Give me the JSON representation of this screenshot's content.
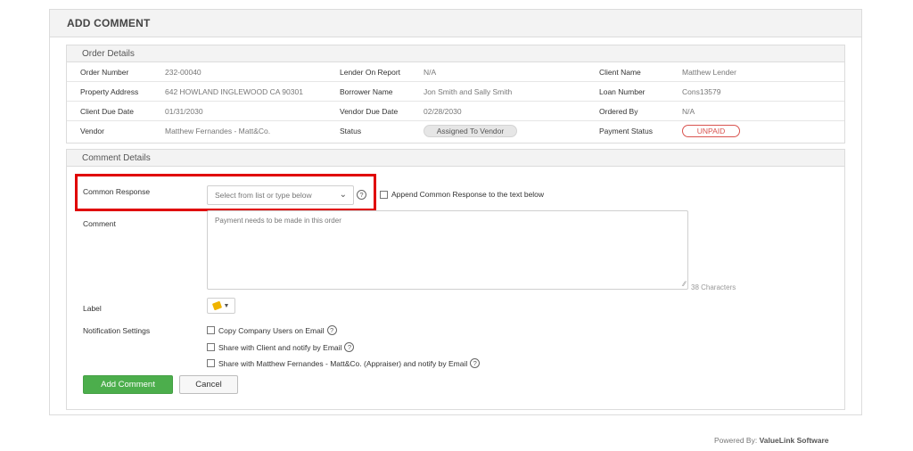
{
  "header": {
    "title": "ADD COMMENT"
  },
  "order_details": {
    "title": "Order Details",
    "rows": [
      [
        {
          "label": "Order Number",
          "value": "232-00040"
        },
        {
          "label": "Lender On Report",
          "value": "N/A"
        },
        {
          "label": "Client Name",
          "value": "Matthew Lender"
        }
      ],
      [
        {
          "label": "Property Address",
          "value": "642 HOWLAND INGLEWOOD CA 90301"
        },
        {
          "label": "Borrower Name",
          "value": "Jon Smith and Sally Smith"
        },
        {
          "label": "Loan Number",
          "value": "Cons13579"
        }
      ],
      [
        {
          "label": "Client Due Date",
          "value": "01/31/2030"
        },
        {
          "label": "Vendor Due Date",
          "value": "02/28/2030"
        },
        {
          "label": "Ordered By",
          "value": "N/A"
        }
      ],
      [
        {
          "label": "Vendor",
          "value": "Matthew Fernandes - Matt&Co."
        },
        {
          "label": "Status",
          "value": "Assigned To Vendor"
        },
        {
          "label": "Payment Status",
          "value": "UNPAID"
        }
      ]
    ]
  },
  "comment_details": {
    "title": "Comment Details",
    "common_response_label": "Common Response",
    "common_response_placeholder": "Select from list or type below",
    "append_label": "Append Common Response to the text below",
    "comment_label": "Comment",
    "comment_text": "Payment needs to be made in this order",
    "char_count": "38 Characters",
    "label_label": "Label",
    "notification_label": "Notification Settings",
    "notifications": [
      "Copy Company Users on Email",
      "Share with Client and notify by Email",
      "Share with Matthew Fernandes - Matt&Co. (Appraiser) and notify by Email"
    ],
    "add_button": "Add Comment",
    "cancel_button": "Cancel"
  },
  "footer": {
    "prefix": "Powered By:",
    "brand": "ValueLink Software"
  },
  "colors": {
    "accent_green": "#4cae4c",
    "unpaid_red": "#d9534f",
    "highlight_red": "#e00000",
    "tag_yellow": "#f0b400"
  },
  "icons": [
    "help-icon",
    "chevron-down-icon",
    "tag-icon",
    "caret-down-icon",
    "resize-handle-icon"
  ]
}
